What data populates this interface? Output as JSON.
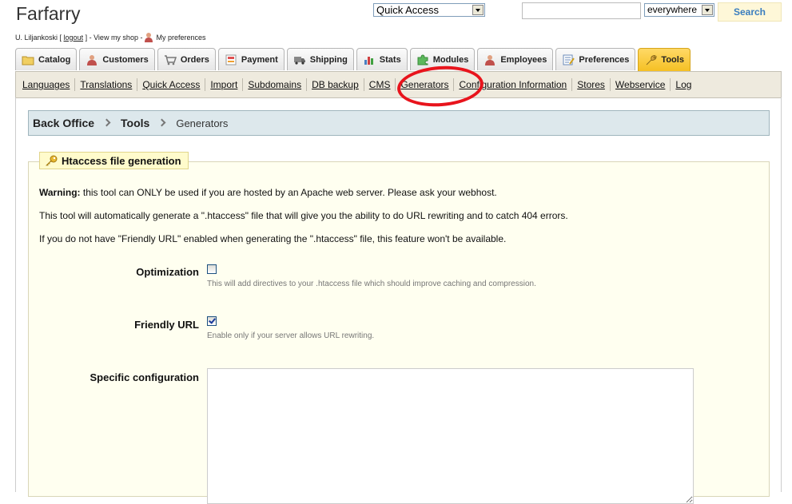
{
  "header": {
    "shop_name": "Farfarry",
    "user": "U. Liljankoski [",
    "logout": "logout",
    "user_sep": "] - View my shop -",
    "my_preferences": "My preferences",
    "quick_access": "Quick Access",
    "search_value": "",
    "search_scope": "everywhere",
    "search_button": "Search"
  },
  "tabs": [
    {
      "label": "Catalog",
      "icon": "folder-icon",
      "color": "#e8c15a"
    },
    {
      "label": "Customers",
      "icon": "person-icon",
      "color": "#c0504d"
    },
    {
      "label": "Orders",
      "icon": "cart-icon",
      "color": "#8a8a8a"
    },
    {
      "label": "Payment",
      "icon": "payment-icon",
      "color": "#d66"
    },
    {
      "label": "Shipping",
      "icon": "truck-icon",
      "color": "#666"
    },
    {
      "label": "Stats",
      "icon": "bar-chart-icon",
      "color": "#4a7fc1"
    },
    {
      "label": "Modules",
      "icon": "puzzle-icon",
      "color": "#4caf50"
    },
    {
      "label": "Employees",
      "icon": "person-icon",
      "color": "#c0504d"
    },
    {
      "label": "Preferences",
      "icon": "form-icon",
      "color": "#6a8ab8"
    },
    {
      "label": "Tools",
      "icon": "wrench-icon",
      "color": "#b08a2a",
      "active": true
    }
  ],
  "subnav": [
    "Languages",
    "Translations",
    "Quick Access",
    "Import",
    "Subdomains",
    "DB backup",
    "CMS",
    "Generators",
    "Configuration Information",
    "Stores",
    "Webservice",
    "Log"
  ],
  "breadcrumb": {
    "root": "Back Office",
    "section": "Tools",
    "current": "Generators"
  },
  "panel": {
    "legend": "Htaccess file generation",
    "warning_label": "Warning:",
    "warning_text": " this tool can ONLY be used if you are hosted by an Apache web server. Please ask your webhost.",
    "info1": "This tool will automatically generate a \".htaccess\" file that will give you the ability to do URL rewriting and to catch 404 errors.",
    "info2": "If you do not have \"Friendly URL\" enabled when generating the \".htaccess\" file, this feature won't be available.",
    "optimization_label": "Optimization",
    "optimization_checked": false,
    "optimization_hint": "This will add directives to your .htaccess file which should improve caching and compression.",
    "friendly_label": "Friendly URL",
    "friendly_checked": true,
    "friendly_hint": "Enable only if your server allows URL rewriting.",
    "specific_label": "Specific configuration",
    "specific_value": ""
  },
  "colors": {
    "active_tab": "#f5c024",
    "highlight": "#e8141c",
    "search_text": "#3a7dbf"
  }
}
